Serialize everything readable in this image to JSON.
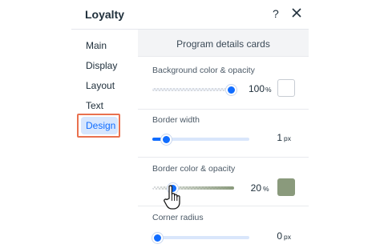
{
  "panel": {
    "title": "Loyalty",
    "help_label": "?"
  },
  "sidebar": {
    "items": [
      {
        "label": "Main"
      },
      {
        "label": "Display"
      },
      {
        "label": "Layout"
      },
      {
        "label": "Text"
      },
      {
        "label": "Design",
        "active": true
      }
    ]
  },
  "content": {
    "section_title": "Program details cards",
    "background": {
      "label": "Background color & opacity",
      "value": "100",
      "unit": "%",
      "level": 1.0,
      "swatch_color": "#ffffff"
    },
    "border_width": {
      "label": "Border width",
      "value": "1",
      "unit": "px",
      "level": 0.11
    },
    "border_color": {
      "label": "Border color & opacity",
      "value": "20",
      "unit": "%",
      "level": 0.2,
      "swatch_color": "#8a9a7c"
    },
    "corner_radius": {
      "label": "Corner radius",
      "value": "0",
      "unit": "px",
      "level": 0.0
    }
  },
  "colors": {
    "accent": "#116dff",
    "highlight_frame": "#e9714f",
    "active_bg": "#d6e6fe"
  }
}
